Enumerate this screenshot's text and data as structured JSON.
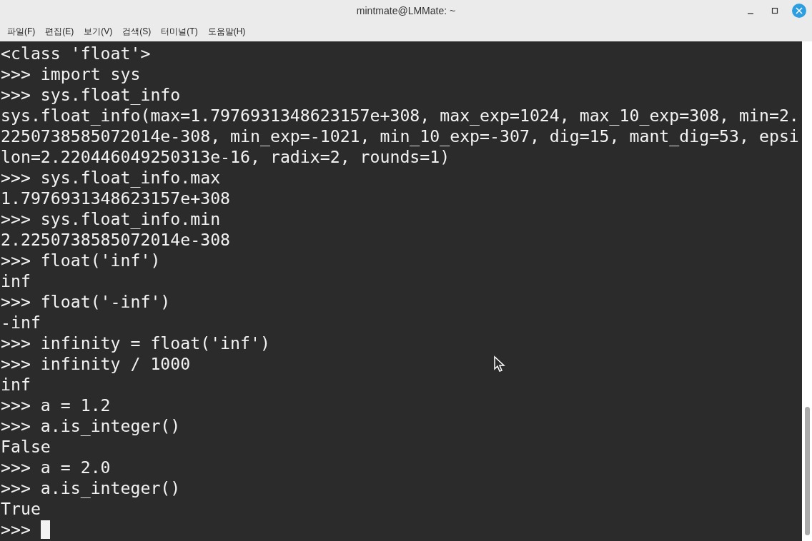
{
  "window": {
    "title": "mintmate@LMMate: ~"
  },
  "menu": [
    "파일(F)",
    "편집(E)",
    "보기(V)",
    "검색(S)",
    "터미널(T)",
    "도움말(H)"
  ],
  "terminal": {
    "lines": [
      "<class 'float'>",
      ">>> import sys",
      ">>> sys.float_info",
      "sys.float_info(max=1.7976931348623157e+308, max_exp=1024, max_10_exp=308, min=2.",
      "2250738585072014e-308, min_exp=-1021, min_10_exp=-307, dig=15, mant_dig=53, epsi",
      "lon=2.220446049250313e-16, radix=2, rounds=1)",
      ">>> sys.float_info.max",
      "1.7976931348623157e+308",
      ">>> sys.float_info.min",
      "2.2250738585072014e-308",
      ">>> float('inf')",
      "inf",
      ">>> float('-inf')",
      "-inf",
      ">>> infinity = float('inf')",
      ">>> infinity / 1000",
      "inf",
      ">>> a = 1.2",
      ">>> a.is_integer()",
      "False",
      ">>> a = 2.0",
      ">>> a.is_integer()",
      "True"
    ],
    "prompt": ">>>",
    "cursor": true
  }
}
